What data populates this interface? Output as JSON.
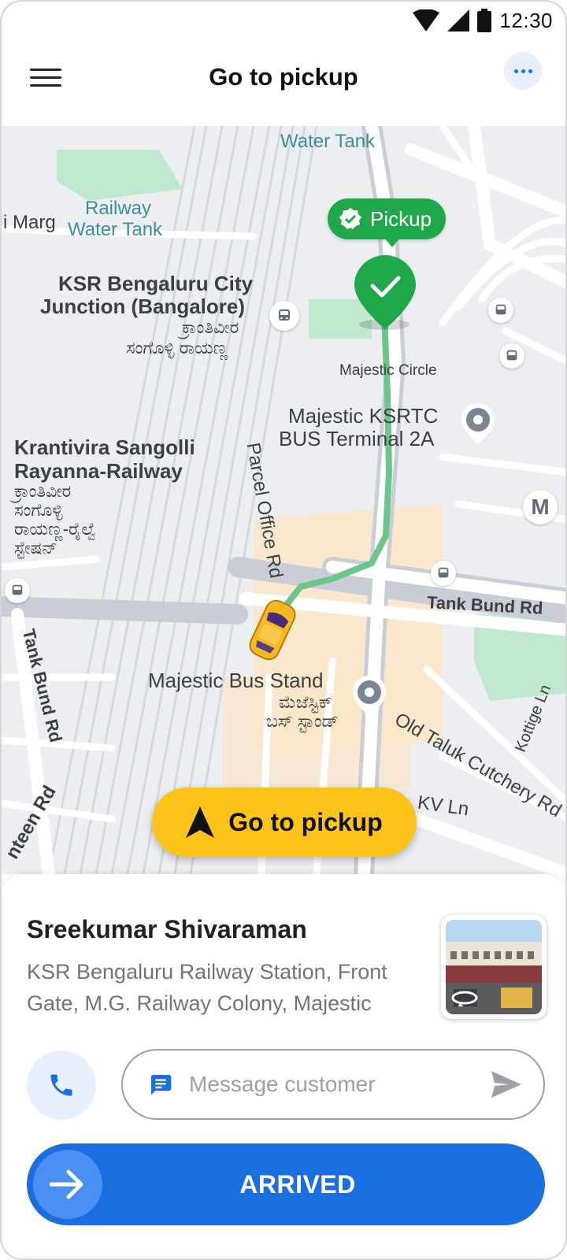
{
  "status_bar": {
    "time": "12:30"
  },
  "header": {
    "title": "Go to pickup"
  },
  "map": {
    "pickup_chip": "Pickup",
    "labels": {
      "water_tank_top": "Water Tank",
      "railway_top": "Railway",
      "railway_water_tank_1": "Railway",
      "railway_water_tank_2": "Water Tank",
      "marg": "i Marg",
      "ksr_1": "KSR Bengaluru City",
      "ksr_2": "Junction (Bangalore)",
      "ksr_kn_1": "ಕ್ರಾಂತಿವೀರ",
      "ksr_kn_2": "ಸಂಗೊಳ್ಳಿ ರಾಯಣ್ಣ",
      "majestic_circle": "Majestic Circle",
      "ksrtc_1": "Majestic KSRTC",
      "ksrtc_2": "BUS Terminal 2A",
      "krantivira_1": "Krantivira Sangolli",
      "krantivira_2": "Rayanna-Railway",
      "krantivira_kn_1": "ಕ್ರಾಂತಿವೀರ",
      "krantivira_kn_2": "ಸಂಗೊಳ್ಳಿ",
      "krantivira_kn_3": "ರಾಯಣ್ಣ-ರೈಲ್ವೆ",
      "krantivira_kn_4": "ಸ್ಟೇಷನ್",
      "parcel_office": "Parcel Office Rd",
      "tank_bund_right": "Tank Bund Rd",
      "tank_bund_left": "Tank Bund Rd",
      "majestic_bus_stand": "Majestic Bus Stand",
      "majestic_bus_stand_kn_1": "ಮೆಜೆಸ್ಟಿಕ್",
      "majestic_bus_stand_kn_2": "ಬಸ್ ಸ್ಟಾಂಡ್",
      "old_taluk": "Old Taluk Cutchery Rd",
      "kottige": "Kottige Ln",
      "kv_ln": "KV Ln",
      "canteen_rd": "nteen Rd",
      "metro": "M"
    },
    "go_button": "Go to pickup"
  },
  "customer": {
    "name": "Sreekumar Shivaraman",
    "address": "KSR Bengaluru Railway Station, Front Gate, M.G. Railway Colony, Majestic"
  },
  "message": {
    "placeholder": "Message customer"
  },
  "arrived": {
    "label": "ARRIVED"
  },
  "colors": {
    "primary": "#1a6ee0",
    "pickup_green": "#1fa84a",
    "go_yellow": "#fcc419",
    "route": "#6cc58a"
  },
  "icons": [
    "wifi-icon",
    "signal-icon",
    "battery-icon",
    "menu-icon",
    "more-icon",
    "check-icon",
    "bus-icon",
    "place-icon",
    "navigation-arrow-icon",
    "phone-icon",
    "message-icon",
    "send-icon",
    "arrow-right-icon",
    "car-icon",
    "street-view-icon"
  ]
}
